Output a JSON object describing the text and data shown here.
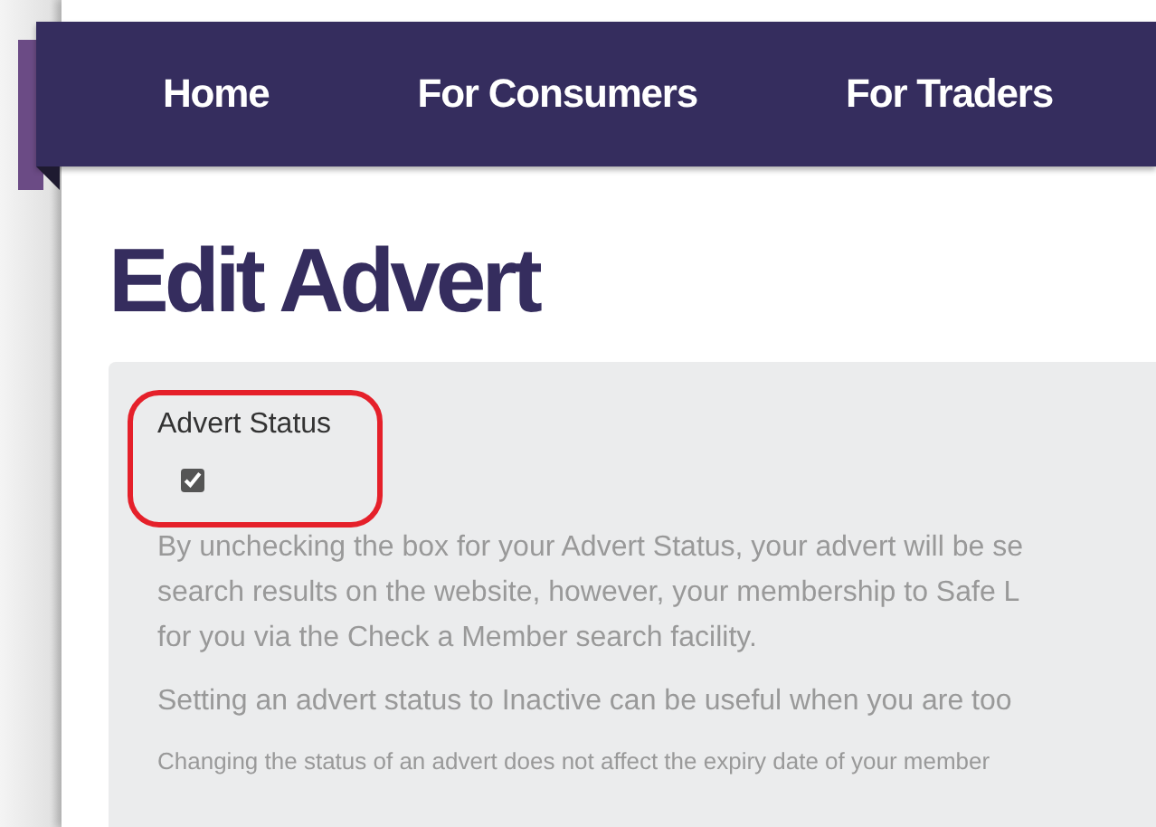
{
  "nav": [
    {
      "label": "Home"
    },
    {
      "label": "For Consumers"
    },
    {
      "label": "For Traders"
    }
  ],
  "heading": "Edit Advert",
  "advert_status": {
    "label": "Advert Status",
    "checked": true
  },
  "info": [
    {
      "kind": "paragraph",
      "lines": [
        "By unchecking the box for your Advert Status, your advert will be se",
        "search results on the website, however, your membership to Safe L",
        "for you via the Check a Member search facility."
      ]
    },
    {
      "kind": "paragraph",
      "lines": [
        "Setting an advert status to Inactive can be useful when you are too"
      ]
    },
    {
      "kind": "note",
      "lines": [
        "Changing the status of an advert does not affect the expiry date of your member"
      ]
    }
  ]
}
